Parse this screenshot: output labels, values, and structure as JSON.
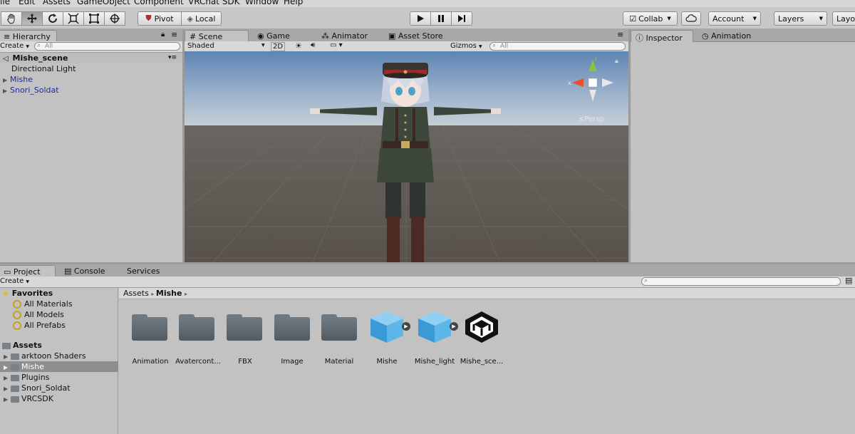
{
  "menu": [
    "ile",
    "Edit",
    "Assets",
    "GameObject",
    "Component",
    "VRChat SDK",
    "Window",
    "Help"
  ],
  "toolbar": {
    "tools": [
      "hand-icon",
      "move-icon",
      "rotate-icon",
      "scale-icon",
      "rect-icon",
      "transform-icon"
    ],
    "pivot_label": "Pivot",
    "local_label": "Local",
    "collab_label": "Collab",
    "account_label": "Account",
    "layers_label": "Layers",
    "layout_label": "Layo"
  },
  "hierarchy": {
    "tab": "Hierarchy",
    "create": "Create",
    "search_placeholder": "All",
    "scene": "Mishe_scene",
    "items": [
      "Directional Light",
      "Mishe",
      "Snori_Soldat"
    ]
  },
  "scene_view": {
    "tabs": [
      "Scene",
      "Game",
      "Animator",
      "Asset Store"
    ],
    "shading": "Shaded",
    "mode_2d": "2D",
    "gizmos": "Gizmos",
    "search_placeholder": "All",
    "persp_label": "Persp",
    "axis_labels": {
      "x": "x",
      "y": "y"
    }
  },
  "inspector": {
    "tabs": [
      "Inspector",
      "Animation"
    ]
  },
  "project": {
    "tabs": [
      "Project",
      "Console",
      "Services"
    ],
    "create": "Create",
    "favorites_label": "Favorites",
    "favorites": [
      "All Materials",
      "All Models",
      "All Prefabs"
    ],
    "assets_label": "Assets",
    "asset_folders": [
      "arktoon Shaders",
      "Mishe",
      "Plugins",
      "Snori_Soldat",
      "VRCSDK"
    ],
    "selected_folder": "Mishe",
    "breadcrumb": [
      "Assets",
      "Mishe"
    ],
    "items": [
      {
        "name": "Animation",
        "kind": "folder"
      },
      {
        "name": "Avatercont...",
        "kind": "folder"
      },
      {
        "name": "FBX",
        "kind": "folder"
      },
      {
        "name": "Image",
        "kind": "folder"
      },
      {
        "name": "Material",
        "kind": "folder"
      },
      {
        "name": "Mishe",
        "kind": "prefab"
      },
      {
        "name": "Mishe_light",
        "kind": "prefab"
      },
      {
        "name": "Mishe_sce...",
        "kind": "scene"
      }
    ]
  }
}
